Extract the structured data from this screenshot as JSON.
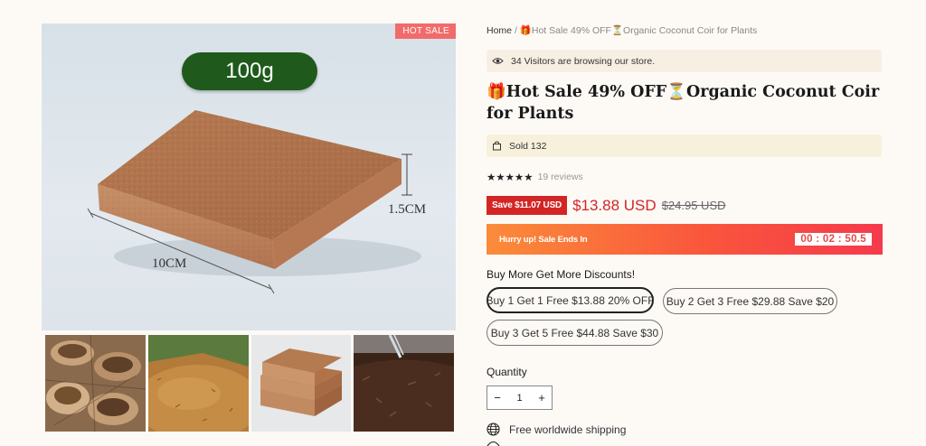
{
  "gallery": {
    "badge": "HOT SALE",
    "weight_label": "100g",
    "width_label": "10CM",
    "height_label": "1.5CM"
  },
  "breadcrumb": {
    "home": "Home",
    "separator": "/",
    "current": "🎁Hot Sale 49% OFF⏳Organic Coconut Coir for Plants"
  },
  "visitors": {
    "text": "34 Visitors are browsing our store."
  },
  "product": {
    "title": "🎁Hot Sale 49% OFF⏳Organic Coconut Coir for Plants",
    "sold": "Sold 132",
    "rating": 5,
    "reviews": "19 reviews",
    "save_badge": "Save $11.07 USD",
    "price": "$13.88 USD",
    "compare_price": "$24.95 USD"
  },
  "countdown": {
    "text": "Hurry up! Sale Ends In",
    "time": "00 : 02 : 50.5"
  },
  "bundles": {
    "title": "Buy More Get More Discounts!",
    "options": [
      "Buy 1 Get 1 Free $13.88 20% OFF",
      "Buy 2 Get 3 Free $29.88 Save $20",
      "Buy 3 Get 5 Free $44.88 Save $30"
    ],
    "selected": "Buy 1 Get 1 Free $13.88 20% OFF"
  },
  "quantity": {
    "label": "Quantity",
    "value": "1",
    "minus": "−",
    "plus": "+"
  },
  "shipping": {
    "text": "Free worldwide shipping"
  },
  "colors": {
    "accent_red": "#d42525",
    "timer_start": "#fb8c3a",
    "timer_end": "#f53a4c",
    "brand_green": "#1f5a1c"
  }
}
